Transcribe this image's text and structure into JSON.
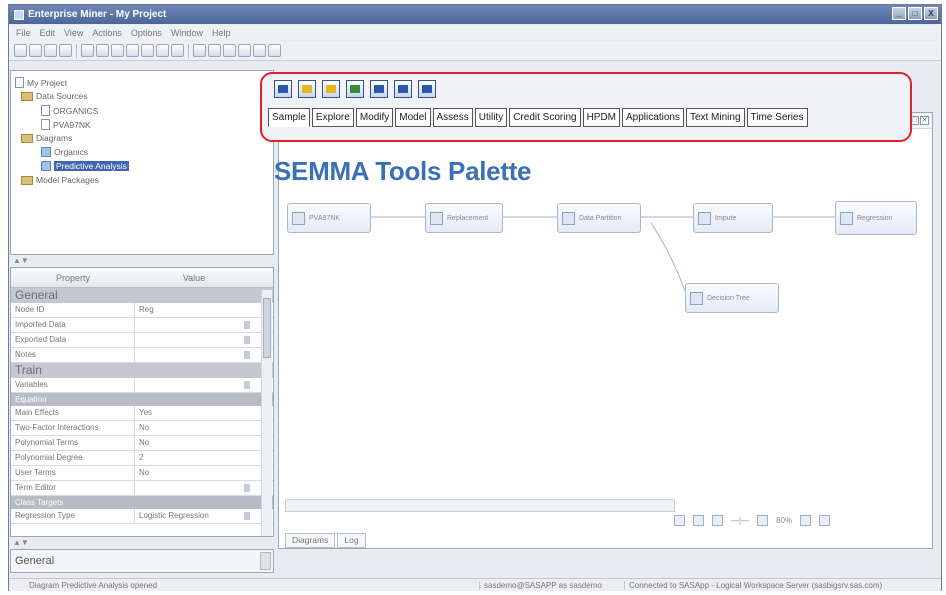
{
  "window": {
    "title": "Enterprise Miner - My Project",
    "buttons": [
      "_",
      "□",
      "X"
    ]
  },
  "menu": [
    "File",
    "Edit",
    "View",
    "Actions",
    "Options",
    "Window",
    "Help"
  ],
  "tree": {
    "root": "My Project",
    "data_sources": "Data Sources",
    "organics": "ORGANICS",
    "pvaftw": "PVA97NK",
    "diagrams": "Diagrams",
    "diag_organics": "Organics",
    "predictive": "Predictive Analysis",
    "model_packages": "Model Packages"
  },
  "props": {
    "col_property": "Property",
    "col_value": "Value",
    "sections": {
      "general": "General",
      "train": "Train",
      "equation": "Equation",
      "class_targets": "Class Targets"
    },
    "general_rows": [
      {
        "k": "Node ID",
        "v": "Reg"
      },
      {
        "k": "Imported Data",
        "v": ""
      },
      {
        "k": "Exported Data",
        "v": ""
      },
      {
        "k": "Notes",
        "v": ""
      }
    ],
    "train_rows": [
      {
        "k": "Variables",
        "v": ""
      }
    ],
    "equation_rows": [
      {
        "k": "Main Effects",
        "v": "Yes"
      },
      {
        "k": "Two-Factor Interactions",
        "v": "No"
      },
      {
        "k": "Polynomial Terms",
        "v": "No"
      },
      {
        "k": "Polynomial Degree",
        "v": "2"
      },
      {
        "k": "User Terms",
        "v": "No"
      },
      {
        "k": "Term Editor",
        "v": ""
      }
    ],
    "class_rows": [
      {
        "k": "Regression Type",
        "v": "Logistic Regression"
      }
    ]
  },
  "bottom_general": "General",
  "status": {
    "left": "Diagram Predictive Analysis opened",
    "mid": "sasdemo@SASAPP as sasdemo",
    "right": "Connected to SASApp - Logical Workspace Server (sasbigsrv.sas.com)"
  },
  "palette": {
    "tabs": [
      "Sample",
      "Explore",
      "Modify",
      "Model",
      "Assess",
      "Utility",
      "Credit Scoring",
      "HPDM",
      "Applications",
      "Text Mining",
      "Time Series"
    ],
    "active_tab": "Sample",
    "icons": [
      "append-icon",
      "data-partition-icon",
      "file-import-icon",
      "filter-icon",
      "input-data-icon",
      "merge-icon",
      "sample-icon"
    ]
  },
  "overlay_title": "SEMMA Tools Palette",
  "flow": {
    "input": "PVA97NK",
    "replacement": "Replacement",
    "partition": "Data Partition",
    "impute": "Impute",
    "regression": "Regression",
    "tree": "Decision Tree"
  },
  "zoom": "80%",
  "diagram_tabs": [
    "Diagrams",
    "Log"
  ]
}
